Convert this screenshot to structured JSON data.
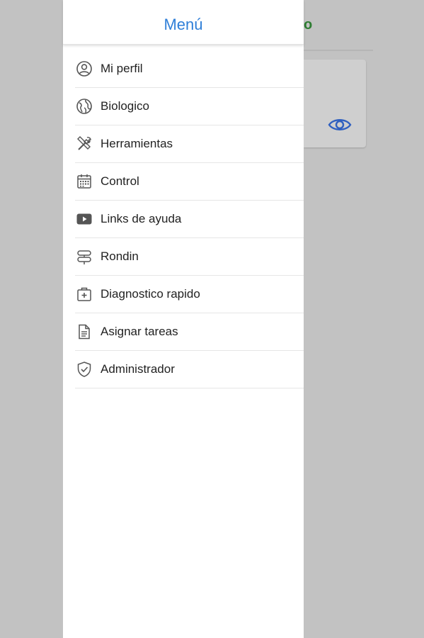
{
  "background": {
    "header_text": "o",
    "card_icon": "eye-icon"
  },
  "drawer": {
    "title": "Menú",
    "items": [
      {
        "label": "Mi perfil",
        "icon": "user-circle-icon"
      },
      {
        "label": "Biologico",
        "icon": "globe-icon"
      },
      {
        "label": "Herramientas",
        "icon": "tools-icon"
      },
      {
        "label": "Control",
        "icon": "calendar-icon"
      },
      {
        "label": "Links de ayuda",
        "icon": "youtube-icon"
      },
      {
        "label": "Rondin",
        "icon": "signpost-icon"
      },
      {
        "label": "Diagnostico rapido",
        "icon": "medical-kit-icon"
      },
      {
        "label": "Asignar tareas",
        "icon": "document-icon"
      },
      {
        "label": "Administrador",
        "icon": "shield-check-icon"
      }
    ]
  },
  "colors": {
    "accent": "#2f7fd8",
    "overlay": "#c2c2c2",
    "header_green": "#2e7d32"
  }
}
